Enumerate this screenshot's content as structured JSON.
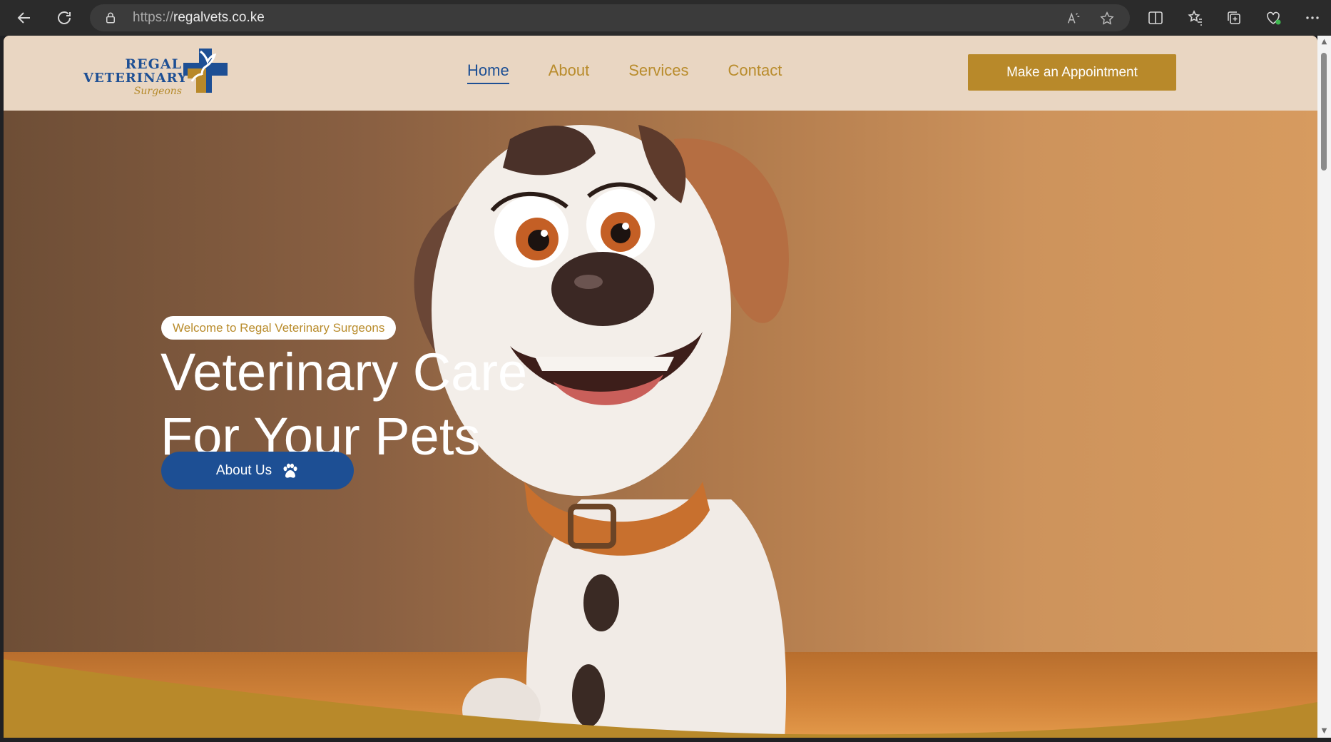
{
  "browser": {
    "url_protocol": "https://",
    "url_host": "regalvets.co.ke"
  },
  "site": {
    "logo": {
      "line1": "REGAL",
      "line2": "VETERINARY",
      "line3": "Surgeons"
    },
    "nav": [
      {
        "label": "Home",
        "active": true
      },
      {
        "label": "About",
        "active": false
      },
      {
        "label": "Services",
        "active": false
      },
      {
        "label": "Contact",
        "active": false
      }
    ],
    "cta_label": "Make an Appointment"
  },
  "hero": {
    "welcome": "Welcome to Regal Veterinary Surgeons",
    "title_line1": "Veterinary Care",
    "title_line2": "For Your Pets",
    "button_label": "About Us",
    "button_icon": "paw-icon"
  },
  "colors": {
    "brand_blue": "#1d4f94",
    "brand_gold": "#b8892a",
    "header_bg": "#e9d6c2"
  }
}
